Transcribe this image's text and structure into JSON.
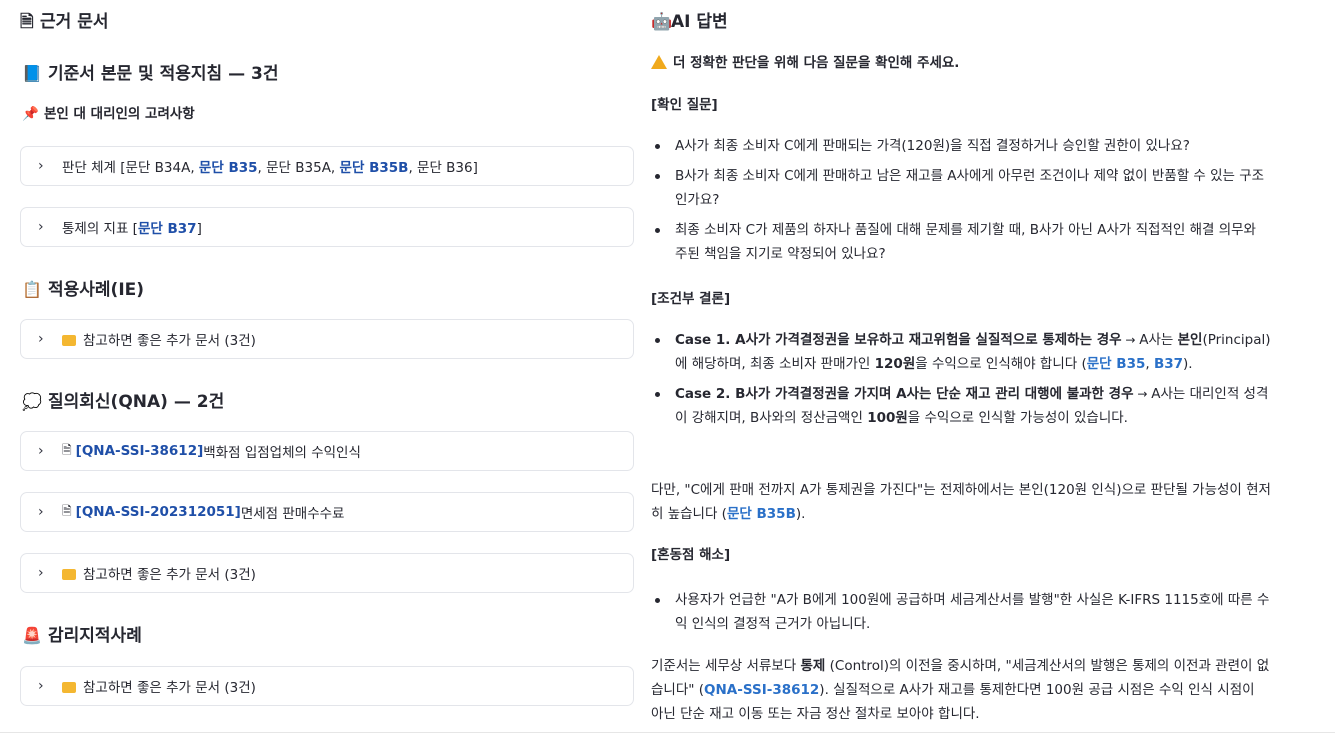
{
  "left": {
    "panel_title": "근거 문서",
    "section1": {
      "title": "기준서 본문 및 적용지침 — 3건"
    },
    "subsection1": {
      "title": "본인 대 대리인의 고려사항"
    },
    "exp1": {
      "a": "판단 체계 [문단 B34A, ",
      "b": "문단 B35",
      "c": ", 문단 B35A, ",
      "d": "문단 B35B",
      "e": ", 문단 B36]"
    },
    "exp2": {
      "a": "통제의 지표 [",
      "b": "문단 B37",
      "c": "]"
    },
    "section2": {
      "title": "적용사례(IE)"
    },
    "exp3": {
      "label": "참고하면 좋은 추가 문서 (3건)"
    },
    "section3": {
      "title": "질의회신(QNA) — 2건"
    },
    "exp4": {
      "id": "[QNA-SSI-38612]",
      "text": " 백화점 입점업체의 수익인식"
    },
    "exp5": {
      "id": "[QNA-SSI-202312051]",
      "text": " 면세점 판매수수료"
    },
    "exp6": {
      "label": "참고하면 좋은 추가 문서 (3건)"
    },
    "section4": {
      "title": "감리지적사례"
    },
    "exp7": {
      "label": "참고하면 좋은 추가 문서 (3건)"
    }
  },
  "right": {
    "panel_title": "AI 답변",
    "warning": "더 정확한 판단을 위해 다음 질문을 확인해 주세요.",
    "h_questions": "[확인 질문]",
    "q1": "A사가 최종 소비자 C에게 판매되는 가격(120원)을 직접 결정하거나 승인할 권한이 있나요?",
    "q2": "B사가 최종 소비자 C에게 판매하고 남은 재고를 A사에게 아무런 조건이나 제약 없이 반품할 수 있는 구조인가요?",
    "q3": "최종 소비자 C가 제품의 하자나 품질에 대해 문제를 제기할 때, B사가 아닌 A사가 직접적인 해결 의무와 주된 책임을 지기로 약정되어 있나요?",
    "h_conclusion": "[조건부 결론]",
    "c1": {
      "bold": "Case 1. A사가 가격결정권을 보유하고 재고위험을 실질적으로 통제하는 경우",
      "arrow": " → ",
      "t1": "A사는 ",
      "b1": "본인",
      "t2": "(Principal)에 해당하며, 최종 소비자 판매가인 ",
      "b2": "120원",
      "t3": "을 수익으로 인식해야 합니다 (",
      "l1": "문단 B35",
      "t4": ", ",
      "l2": "B37",
      "t5": ")."
    },
    "c2": {
      "bold": "Case 2. B사가 가격결정권을 가지며 A사는 단순 재고 관리 대행에 불과한 경우",
      "arrow": " → ",
      "t1": "A사는 대리인적 성격이 강해지며, B사와의 정산금액인 ",
      "b1": "100원",
      "t2": "을 수익으로 인식할 가능성이 있습니다."
    },
    "p1": {
      "t1": "다만, \"C에게 판매 전까지 A가 통제권을 가진다\"는 전제하에서는 본인(120원 인식)으로 판단될 가능성이 현저히 높습니다 (",
      "l1": "문단 B35B",
      "t2": ")."
    },
    "h_confusion": "[혼동점 해소]",
    "r1": "사용자가 언급한 \"A가 B에게 100원에 공급하며 세금계산서를 발행\"한 사실은 K-IFRS 1115호에 따른 수익 인식의 결정적 근거가 아닙니다.",
    "p2": {
      "t1": "기준서는 세무상 서류보다 ",
      "b1": "통제",
      "t2": " (Control)의 이전을 중시하며, \"세금계산서의 발행은 통제의 이전과 관련이 없습니다\" (",
      "l1": "QNA-SSI-38612",
      "t3": "). 실질적으로 A사가 재고를 통제한다면 100원 공급 시점은 수익 인식 시점이 아닌 단순 재고 이동 또는 자금 정산 절차로 보아야 합니다."
    }
  }
}
